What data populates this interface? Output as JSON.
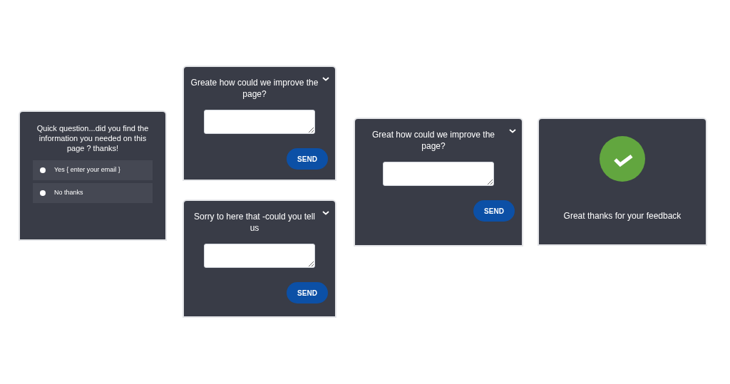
{
  "cards": [
    {
      "kind": "survey",
      "question": "Quick question...did you find the information you needed on this page ? thanks!",
      "options": [
        {
          "label": "Yes { enter your email }",
          "selected": false
        },
        {
          "label": "No thanks",
          "selected": false
        }
      ]
    },
    {
      "kind": "comment",
      "question": "Greate how could we improve the page?",
      "button": "SEND"
    },
    {
      "kind": "comment",
      "question": "Sorry to here that -could you tell us",
      "button": "SEND"
    },
    {
      "kind": "comment",
      "question": "Great how could we improve the page?",
      "button": "SEND"
    },
    {
      "kind": "thanks",
      "message": "Great thanks for your feedback"
    }
  ]
}
